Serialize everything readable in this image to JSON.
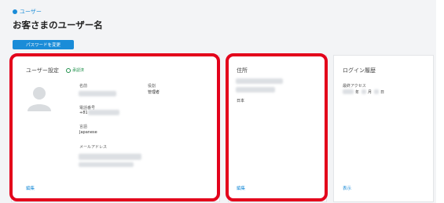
{
  "breadcrumb": {
    "icon": "circle-back-icon",
    "label": "ユーザー"
  },
  "page_title": "お客さまのユーザー名",
  "password_button": "パスワードを変更",
  "user_card": {
    "title": "ユーザー設定",
    "status": "承認済",
    "fields": {
      "name_label": "名前",
      "role_label": "役割",
      "role_value": "管理者",
      "phone_label": "電話番号",
      "phone_value": "+81",
      "language_label": "言語",
      "language_value": "Japanese",
      "email_label": "メールアドレス"
    },
    "edit_link": "編集"
  },
  "address_card": {
    "title": "住所",
    "country": "日本",
    "edit_link": "編集"
  },
  "login_card": {
    "title": "ログイン履歴",
    "last_access_label": "最終アクセス",
    "date_year_suffix": "年",
    "date_month_suffix": "月",
    "date_day_suffix": "日",
    "view_link": "表示"
  },
  "colors": {
    "accent": "#1a8cd8",
    "highlight": "#e3001b",
    "success": "#1e8f4a"
  }
}
